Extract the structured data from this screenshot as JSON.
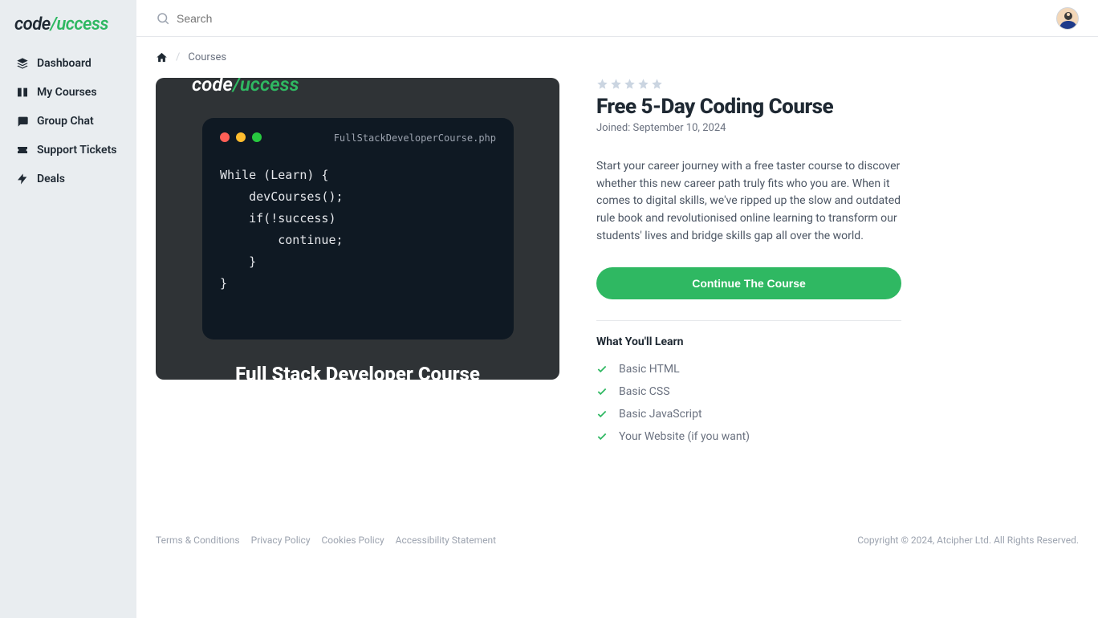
{
  "brand": {
    "part1": "code",
    "part2": "/uccess"
  },
  "search": {
    "placeholder": "Search"
  },
  "sidebar": {
    "items": [
      {
        "label": "Dashboard"
      },
      {
        "label": "My Courses"
      },
      {
        "label": "Group Chat"
      },
      {
        "label": "Support Tickets"
      },
      {
        "label": "Deals"
      }
    ]
  },
  "breadcrumb": {
    "current": "Courses"
  },
  "course": {
    "title": "Free 5-Day Coding Course",
    "joined": "Joined: September 10, 2024",
    "description": "Start your career journey with a free taster course to discover whether this new career path truly fits who you are. When it comes to digital skills, we've ripped up the slow and outdated rule book and revolutionised online learning to transform our students' lives and bridge skills gap all over the world.",
    "button": "Continue The Course",
    "learn_title": "What You'll Learn",
    "learn_items": [
      "Basic HTML",
      "Basic CSS",
      "Basic JavaScript",
      "Your Website (if you want)"
    ]
  },
  "image_card": {
    "filename": "FullStackDeveloperCourse.php",
    "code": "While (Learn) {\n    devCourses();\n    if(!success)\n        continue;\n    }\n}",
    "caption": "Full Stack Developer Course"
  },
  "footer": {
    "links": [
      "Terms & Conditions",
      "Privacy Policy",
      "Cookies Policy",
      "Accessibility Statement"
    ],
    "copyright": "Copyright © 2024, Atcipher Ltd. All Rights Reserved."
  }
}
